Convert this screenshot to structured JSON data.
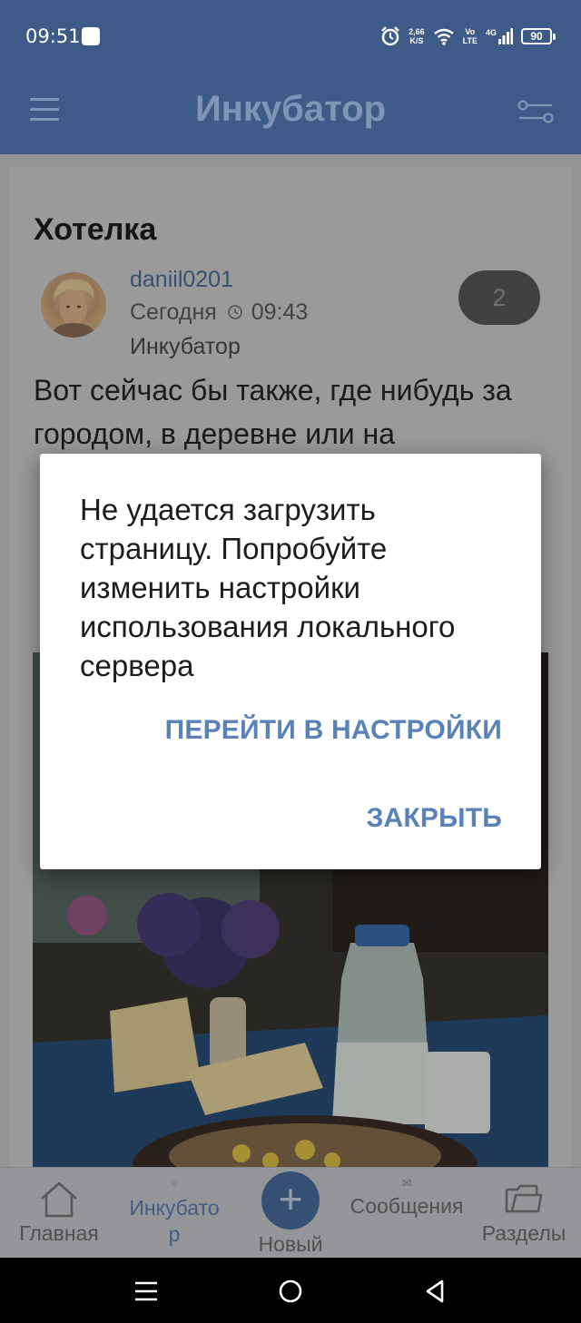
{
  "status_bar": {
    "time": "09:51",
    "net_speed_value": "2,66",
    "net_speed_unit": "K/S",
    "volte_top": "Vo",
    "volte_bottom": "LTE",
    "network_type": "4G",
    "battery": "90",
    "icons": [
      "app-notification-icon",
      "alarm-icon",
      "wifi-icon",
      "signal-icon",
      "battery-icon"
    ]
  },
  "app_bar": {
    "title": "Инкубатор",
    "left_icon": "menu-icon",
    "right_icon": "filter-icon"
  },
  "post": {
    "title": "Хотелка",
    "author": "daniil0201",
    "date_label": "Сегодня",
    "time": "09:43",
    "section": "Инкубатор",
    "comments_count": "2",
    "text": "Вот сейчас бы также, где нибудь за городом, в деревне или на"
  },
  "dialog": {
    "message": "Не удается загрузить страницу. Попробуйте изменить настройки использования локального сервера",
    "settings_button": "ПЕРЕЙТИ В НАСТРОЙКИ",
    "close_button": "ЗАКРЫТЬ"
  },
  "bottom_nav": {
    "items": [
      {
        "label": "Главная",
        "icon": "home-icon"
      },
      {
        "label": "Инкубатор",
        "icon": "incubator-icon",
        "active": true
      },
      {
        "label": "Новый",
        "icon": "plus-icon"
      },
      {
        "label": "Сообщения",
        "icon": "mail-icon"
      },
      {
        "label": "Разделы",
        "icon": "folder-icon"
      }
    ]
  },
  "system_nav": {
    "buttons": [
      "recent-apps-icon",
      "home-circle-icon",
      "back-triangle-icon"
    ]
  },
  "colors": {
    "header_bg": "#3e5a86",
    "accent": "#5a82b8",
    "dialog_bg": "#ffffff"
  }
}
